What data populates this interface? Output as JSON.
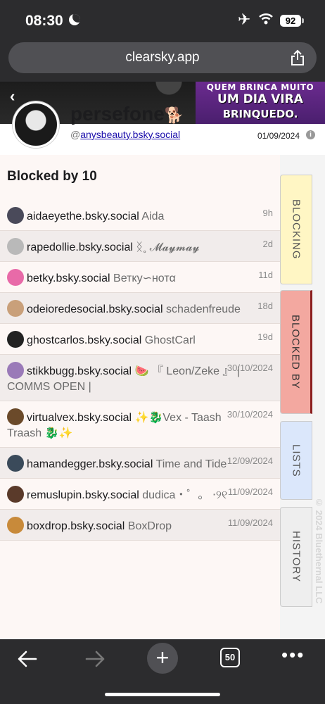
{
  "status_bar": {
    "time": "08:30",
    "battery": "92"
  },
  "browser": {
    "url": "clearsky.app",
    "tab_count": "50"
  },
  "banner": {
    "line1": "QUEM BRINCA MUITO",
    "line2": "UM DIA VIRA",
    "line3": "BRINQUEDO."
  },
  "profile": {
    "display_name": "persefone",
    "handle_prefix": "@",
    "handle": "anysbeauty.bsky.social",
    "date": "01/09/2024"
  },
  "panel": {
    "title": "Blocked by 10"
  },
  "blockers": [
    {
      "handle": "aidaeyethe.bsky.social",
      "name": "Aida",
      "time": "9h",
      "avatar_color": "#4a4a5a"
    },
    {
      "handle": "rapedollie.bsky.social",
      "name": "ᛝ˳ 𝓜𝓪𝔂𝓶𝓪𝔂",
      "time": "2d",
      "avatar_color": "#b9b9b9"
    },
    {
      "handle": "betky.bsky.social",
      "name": "Ветку∽нотα",
      "time": "11d",
      "avatar_color": "#e86aa8"
    },
    {
      "handle": "odeioredesocial.bsky.social",
      "name": "schadenfreude",
      "time": "18d",
      "avatar_color": "#c9a07a"
    },
    {
      "handle": "ghostcarlos.bsky.social",
      "name": "GhostCarl",
      "time": "19d",
      "avatar_color": "#222222"
    },
    {
      "handle": "stikkbugg.bsky.social",
      "name": "🍉 『 Leon/Zeke 』 | COMMS OPEN |",
      "time": "30/10/2024",
      "avatar_color": "#9a7ab8"
    },
    {
      "handle": "virtualvex.bsky.social",
      "name": "✨🐉Vex - Taash Traash 🐉✨",
      "time": "30/10/2024",
      "avatar_color": "#6b4a2a"
    },
    {
      "handle": "hamandegger.bsky.social",
      "name": "Time and Tide",
      "time": "12/09/2024",
      "avatar_color": "#3a4a5a"
    },
    {
      "handle": "remuslupin.bsky.social",
      "name": "dudica・゜。 ⋅୨୧",
      "time": "11/09/2024",
      "avatar_color": "#5a3a2a"
    },
    {
      "handle": "boxdrop.bsky.social",
      "name": "BoxDrop",
      "time": "11/09/2024",
      "avatar_color": "#c88a3a"
    }
  ],
  "tabs": {
    "blocking": "BLOCKING",
    "blocked_by": "BLOCKED BY",
    "lists": "LISTS",
    "history": "HISTORY"
  },
  "copyright": "© 2024 Bluethernal LLC",
  "colors": {
    "tab_blocking": "#fff6c4",
    "tab_blocked_by": "#f3a8a0",
    "tab_lists": "#dbe7fb",
    "tab_history": "#eeeeee"
  }
}
